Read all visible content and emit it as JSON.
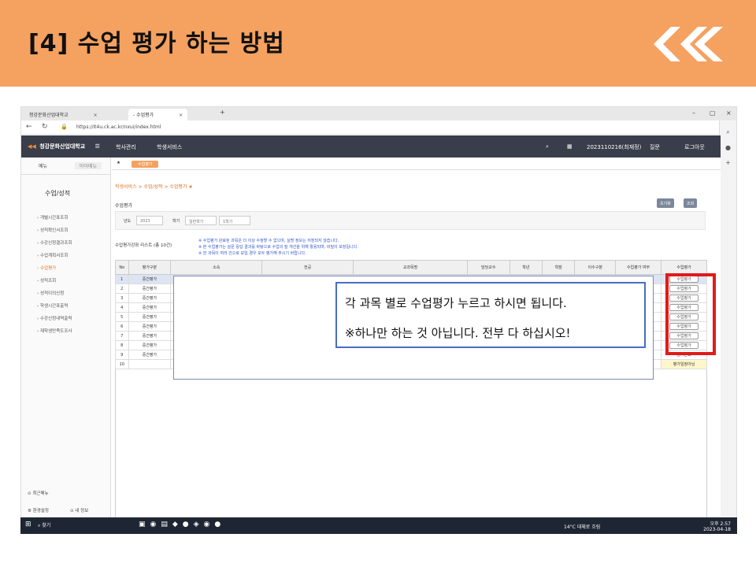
{
  "slide": {
    "title": "[4] 수업 평가 하는 방법"
  },
  "browser": {
    "tabs": [
      {
        "label": "청강문화산업대학교",
        "close": "×"
      },
      {
        "label": "- 수업평가",
        "close": "×"
      }
    ],
    "new_tab": "+",
    "url": "https://it4u.ck.ac.kr/nxui/index.html",
    "window_controls": [
      "–",
      "▢",
      "×"
    ]
  },
  "site": {
    "logo_text": "청강문화산업대학교",
    "menu": [
      "학사관리",
      "학생서비스"
    ],
    "user": "2023110216(최재정)",
    "faq": "질문",
    "logout": "로그아웃"
  },
  "leftnav": {
    "tab_menu": "메뉴",
    "tab_mymenu": "마이메뉴",
    "section": "수업/성적",
    "items": [
      {
        "label": "개별시간표조회"
      },
      {
        "label": "성적확인서조회"
      },
      {
        "label": "수강신청결과조회"
      },
      {
        "label": "수업계획서조회"
      },
      {
        "label": "수업평가",
        "active": true
      },
      {
        "label": "성적조회"
      },
      {
        "label": "성적이의신청"
      },
      {
        "label": "학생시간표출력"
      },
      {
        "label": "수강신청내역출력"
      },
      {
        "label": "재학생만족도조사"
      }
    ],
    "foot1": "최근메뉴",
    "foot2": "환경설정",
    "foot3": "내 정보"
  },
  "main": {
    "tab_label": "수업평가",
    "breadcrumb": "학생서비스 > 수업/성적 > 수업평가 ★",
    "page_heading": "수업평가",
    "btn_init": "초기화",
    "btn_search": "조회",
    "filter": {
      "year_label": "년도",
      "year": "2023",
      "term_label": "학기",
      "term1": "일반학기",
      "term2": "1학기"
    },
    "list_title": "수업평가강좌 리스트 (총 10건)",
    "notes": [
      "※ 수업평가 완료된 과목은 더 이상 수정할 수 없으며, 실명 정보는 저장되지 않습니다.",
      "※ 본 수업평가는 설문 응답 결과를 바탕으로 수업의 질 개선을 위해 활용되며, 비밀이 보장됩니다.",
      "※ 한 과목이 여러 건으로 보일 경우 모두 평가해 주시기 바랍니다."
    ],
    "columns": [
      "No",
      "평가구분",
      "소속",
      "전공",
      "교과목명",
      "담당교수",
      "학년",
      "학점",
      "이수구분",
      "수업평가 여부",
      "수업평가"
    ],
    "rows": [
      {
        "no": "1",
        "type": "중간평가",
        "action": "수업평가"
      },
      {
        "no": "2",
        "type": "중간평가",
        "action": "수업평가"
      },
      {
        "no": "3",
        "type": "중간평가",
        "action": "수업평가"
      },
      {
        "no": "4",
        "type": "중간평가",
        "action": "수업평가"
      },
      {
        "no": "5",
        "type": "중간평가",
        "action": "수업평가"
      },
      {
        "no": "6",
        "type": "중간평가",
        "action": "수업평가"
      },
      {
        "no": "7",
        "type": "중간평가",
        "action": "수업평가"
      },
      {
        "no": "8",
        "type": "중간평가",
        "action": "수업평가"
      },
      {
        "no": "9",
        "type": "중간평가",
        "action": "평가완료"
      },
      {
        "no": "10",
        "type": "",
        "action": "평가일정아님"
      }
    ]
  },
  "callout": {
    "line1": "각 과목 별로 수업평가 누르고 하시면 됩니다.",
    "line2": "※하나만 하는 것 아닙니다. 전부 다 하십시오!"
  },
  "taskbar": {
    "search": "찾기",
    "weather": "14°C 대체로 흐림",
    "time": "오후 2:57",
    "date": "2023-04-18"
  }
}
